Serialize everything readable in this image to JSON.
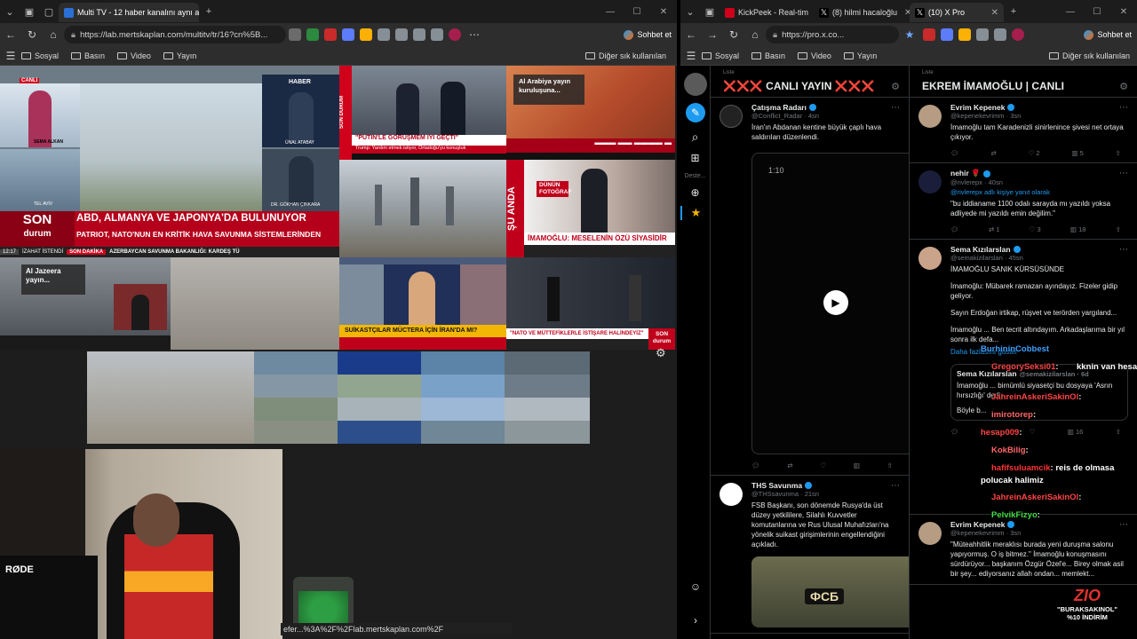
{
  "left_browser": {
    "tabs": [
      {
        "label": "Multi TV - 12 haber kanalını aynı a",
        "active": true
      }
    ],
    "url": "https://lab.mertskaplan.com/multitv/tr/16?cn%5B...",
    "profile_label": "Sohbet et",
    "bookmarks": [
      "Sosyal",
      "Basın",
      "Video",
      "Yayın"
    ],
    "other_bookmarks": "Diğer sık kullanılan",
    "status_url": "efer...%3A%2F%2Flab.mertskaplan.com%2F"
  },
  "right_browser": {
    "tabs": [
      {
        "label": "KickPeek - Real-tim",
        "active": false
      },
      {
        "label": "(8) hilmi hacaloğlu",
        "active": false
      },
      {
        "label": "(10) X Pro",
        "active": true
      }
    ],
    "url": "https://pro.x.co...",
    "profile_label": "Sohbet et",
    "bookmarks": [
      "Sosyal",
      "Basın",
      "Video",
      "Yayın"
    ],
    "other_bookmarks": "Diğer sık kullanılan"
  },
  "tv": {
    "c1_tag": "CANLI",
    "c1_name1": "SEMA ALKAN",
    "c1_city": "TEL AVİV",
    "c1_brand": "HABER",
    "c1_name2": "ÜNAL ATABAY",
    "c1_name3": "DR. GÖKHAN ÇINKARA",
    "c1_head": "ABD, ALMANYA VE JAPONYA'DA BULUNUYOR",
    "c1_sub": "PATRIOT, NATO'NUN EN KRİTİK HAVA SAVUNMA SİSTEMLERİNDEN",
    "c1_son": "SON",
    "c1_durum": "durum",
    "c1_time": "12:17",
    "c1_ticker": "AZERBAYCAN SAVUNMA BAKANLIĞI: KARDEŞ TÜ",
    "c1_ticker_tag": "SON DAKİKA",
    "c1_izahat": "İZAHAT İSTENDİ",
    "c2_head": "\"PUTİN'LE GÖRÜŞMEM İYİ GEÇTİ\"",
    "c2_sub": "Trump: Yardım etmek istiyor, Ortadoğu'yu konuştuk",
    "c2_side": "SON DURUM",
    "c3_title": "Al Arabiya yayın kuruluşuna...",
    "c5_side": "ŞU ANDA",
    "c5_tag": "DÜNÜN FOTOĞRAF",
    "c5_head": "İMAMOĞLU: MESELENİN ÖZÜ SİYASİDİR",
    "c6_title": "Al Jazeera yayın...",
    "c8_head": "SUİKASTÇILAR MÜCTERA İÇİN İRAN'DA MI?",
    "c9_head": "\"NATO VE MÜTTEFİKLERLE İSTİŞARE HALİNDEYİZ\"",
    "c9_tag": "SON durum"
  },
  "xpro": {
    "sidebar_label": "Deste...",
    "col1": {
      "list_label": "Liste",
      "title": "❌❌❌ CANLI YAYIN ❌❌❌",
      "tweets": [
        {
          "name": "Çatışma Radarı",
          "handle": "@Conflict_Radar · 4sn",
          "text": "İran'ın Abdanan kentine büyük çaplı hava saldırıları düzenlendi.",
          "video_time": "1:10"
        },
        {
          "name": "THS Savunma",
          "handle": "@THSsavunma · 21sn",
          "text": "FSB Başkanı, son dönemde Rusya'da üst düzey yetkililere, Silahlı Kuvvetler komutanlarına ve Rus Ulusal Muhafızları'na yönelik suikast girişimlerinin engellendiğini açıkladı.",
          "img_text": "ФСБ"
        }
      ]
    },
    "col2": {
      "list_label": "Liste",
      "title": "EKREM İMAMOĞLU | CANLI",
      "tweets": [
        {
          "name": "Evrim Kepenek",
          "handle": "@kepenekevrimm · 3sn",
          "text": "İmamoğlu tam Karadenizli sinirlenince şivesi net ortaya çıkıyor.",
          "reply": "",
          "likes": "2",
          "views": "5",
          "rts": "",
          "comments": ""
        },
        {
          "name": "nehir 🌹",
          "handle": "@rivlerepx · 40sn",
          "reply": "@rivlerepx adlı kişiye yanıt olarak",
          "text": "\"bu iddianame 1100 odalı sarayda mı yazıldı yoksa adliyede mi yazıldı emin değilim.\"",
          "rts": "1",
          "likes": "3",
          "views": "18",
          "comments": ""
        },
        {
          "name": "Sema Kızılarslan",
          "handle": "@semakizilarslan · 45sn",
          "text": "İMAMOĞLU SANIK KÜRSÜSÜNDE",
          "p2": "İmamoğlu: Mübarek ramazan ayındayız. Fizeler gidip geliyor.",
          "p3": "Sayın Erdoğan irtikap, rüşvet ve terörden yargıland...",
          "p4": "İmamoğlu ... Ben tecrit altındayım. Arkadaşlarıma bir yıl sonra ilk defa...",
          "more": "Daha fazlasını göster",
          "quote_name": "Sema Kızılarslan",
          "quote_handle": "@semakizilarslan · 6d",
          "quote_text": "İmamoğlu ... birnümlü siyasetçi bu dosyaya 'Asrın hırsızlığı' dedi.",
          "quote_text2": "Böyle b...",
          "views": "16"
        },
        {
          "name": "Evrim Kepenek",
          "handle": "@kepenekevrimm · 3sn",
          "text": "\"Müteahhitlik meraklısı burada yeni duruşma salonu yapıyormuş. O iş bitmez.\" İmamoğlu konuşmasını sürdürüyor... başkanım Özgür Özel'e... Birey olmak asil bir şey... ediyorsanız allah ondan... memlekt..."
        }
      ]
    }
  },
  "chat": [
    {
      "user": "BurhininCobbest",
      "msg": "",
      "color": "#3fa0ff"
    },
    {
      "user": "GregorySeksi01",
      "msg": "kknin van hesap",
      "color": "#ff4444"
    },
    {
      "user": "JahreinAskeriSakinOl",
      "msg": "",
      "color": "#ff4444"
    },
    {
      "user": "imirotorep",
      "msg": "",
      "color": "#ff6666"
    },
    {
      "user": "hesap009",
      "msg": "",
      "color": "#ff4444"
    },
    {
      "user": "KokBilig",
      "msg": "",
      "color": "#ff6666"
    },
    {
      "user": "hafifsuluamcik",
      "msg": "reis de olmasa",
      "color": "#ff3333"
    },
    {
      "user": "",
      "msg": "polucak halimiz",
      "color": "#ffffff"
    },
    {
      "user": "JahreinAskeriSakinOl",
      "msg": "",
      "color": "#ff4444"
    },
    {
      "user": "PelvikFizyo",
      "msg": "",
      "color": "#44dd44"
    }
  ],
  "overlay": {
    "brand": "ZIO",
    "code": "\"BURAKSAKINOL\"",
    "discount": "%10 İNDİRİM",
    "mic": "RØDE"
  },
  "colors": {
    "accent_red": "#d0021b",
    "x_blue": "#1d9bf0",
    "x_bg": "#000000",
    "chrome_tab": "#2d2d2d"
  },
  "icons": [
    "menu-icon",
    "workspaces-icon",
    "back-icon",
    "refresh-icon",
    "home-icon",
    "star-icon",
    "more-icon",
    "settings-gear-icon",
    "play-icon",
    "verified-icon",
    "search-icon",
    "close-icon"
  ]
}
